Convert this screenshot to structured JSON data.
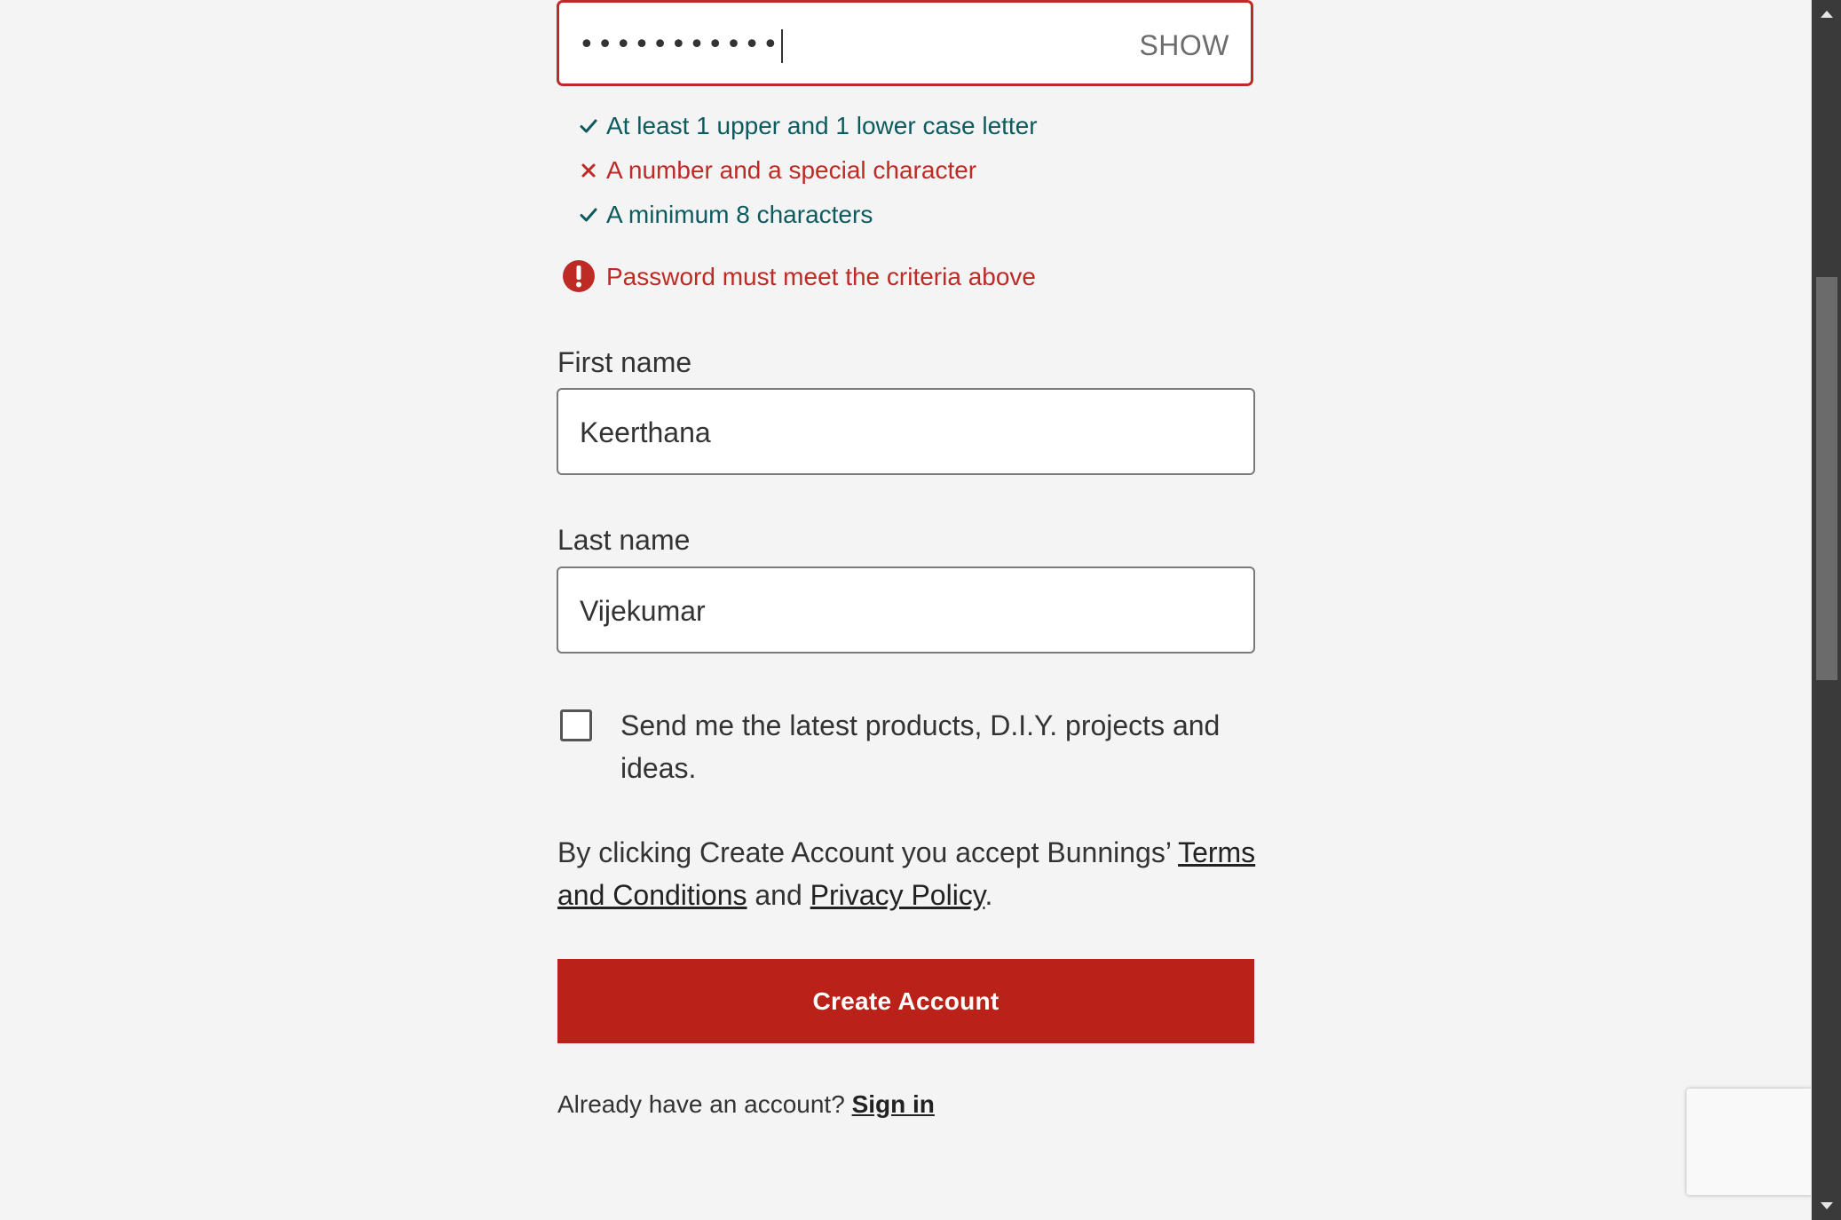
{
  "password": {
    "masked_value": "•••••••••••",
    "show_label": "SHOW"
  },
  "criteria": [
    {
      "status": "met",
      "icon": "check-icon",
      "text": "At least 1 upper and 1 lower case letter"
    },
    {
      "status": "unmet",
      "icon": "cross-icon",
      "text": "A number and a special character"
    },
    {
      "status": "met",
      "icon": "check-icon",
      "text": "A minimum 8 characters"
    }
  ],
  "password_error": "Password must meet the criteria above",
  "first_name": {
    "label": "First name",
    "value": "Keerthana"
  },
  "last_name": {
    "label": "Last name",
    "value": "Vijekumar"
  },
  "marketing_opt_in": {
    "checked": false,
    "label": "Send me the latest products, D.I.Y. projects and ideas."
  },
  "terms": {
    "prefix": "By clicking Create Account you accept Bunnings’ ",
    "terms_link": "Terms and Conditions",
    "middle": " and ",
    "privacy_link": "Privacy Policy",
    "suffix": "."
  },
  "create_button": "Create Account",
  "signin": {
    "prompt": "Already have an account? ",
    "link": "Sign in"
  },
  "colors": {
    "error_red": "#be2b25",
    "success_teal": "#0d5b5e",
    "button_red": "#ba2118",
    "page_bg": "#f4f4f4"
  }
}
